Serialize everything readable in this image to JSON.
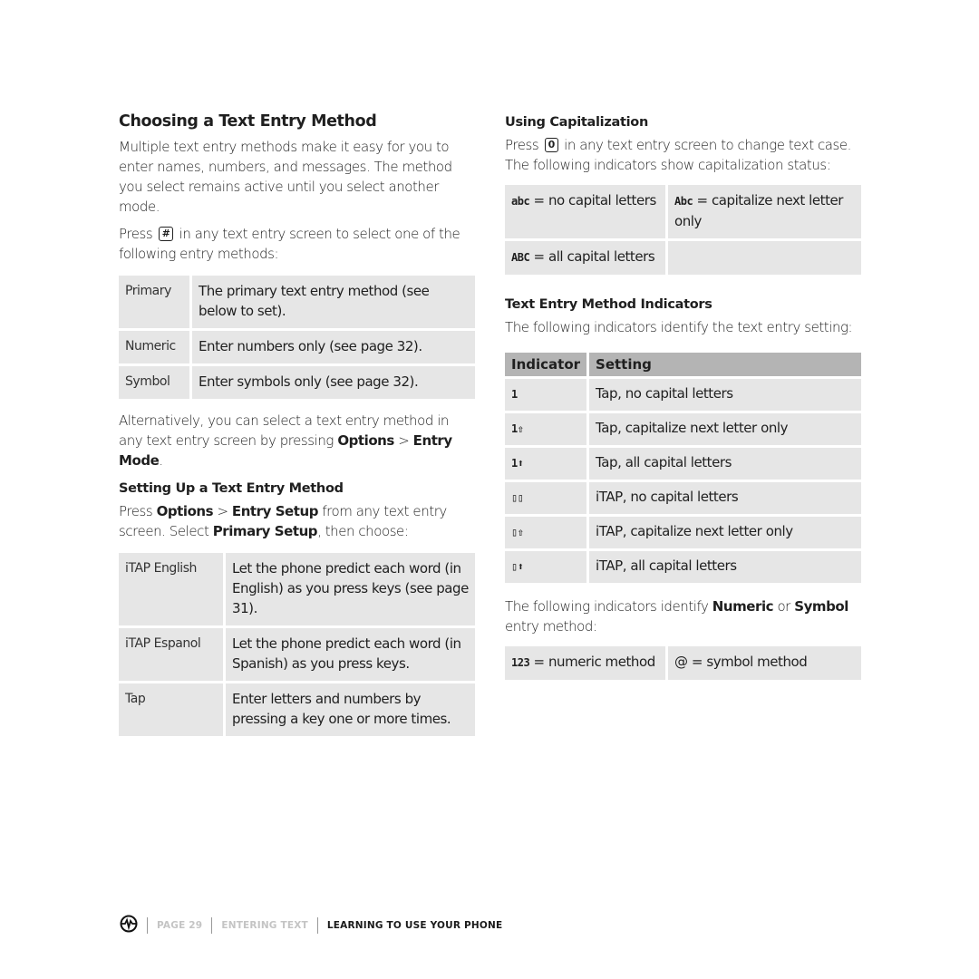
{
  "left": {
    "title": "Choosing a Text Entry Method",
    "intro": "Multiple text entry methods make it easy for you to enter names, numbers, and messages. The method you select remains active until you select another mode.",
    "press_pre": "Press",
    "press_key": "#",
    "press_post": "in any text entry screen to select one of the following entry methods:",
    "methods": [
      {
        "label": "Primary",
        "desc": "The primary text entry method (see below to set)."
      },
      {
        "label": "Numeric",
        "desc": "Enter numbers only (see page 32)."
      },
      {
        "label": "Symbol",
        "desc": "Enter symbols only (see page 32)."
      }
    ],
    "alt_pre": "Alternatively, you can select a text entry method in any text entry screen by pressing",
    "alt_b1": "Options",
    "alt_sep": " > ",
    "alt_b2": "Entry Mode",
    "alt_end": ".",
    "setup_title": "Setting Up a Text Entry Method",
    "setup_pre": "Press",
    "setup_b1": "Options",
    "setup_sep": " > ",
    "setup_b2": "Entry Setup",
    "setup_mid": " from any text entry screen. Select ",
    "setup_b3": "Primary Setup",
    "setup_end": ", then choose:",
    "setups": [
      {
        "label": "iTAP English",
        "desc": "Let the phone predict each word (in English) as you press keys (see page 31)."
      },
      {
        "label": "iTAP Espanol",
        "desc": "Let the phone predict each word (in Spanish) as you press keys."
      },
      {
        "label": "Tap",
        "desc": "Enter letters and numbers by pressing a key one or more times."
      }
    ]
  },
  "right": {
    "cap_title": "Using Capitalization",
    "cap_pre": "Press",
    "cap_key": "0",
    "cap_post": "in any text entry screen to change text case. The following indicators show capitalization status:",
    "cap": {
      "lower_ind": "abc",
      "lower_desc": "= no capital letters",
      "next_ind": "Abc",
      "next_desc": "= capitalize next letter only",
      "all_ind": "ABC",
      "all_desc": "= all capital letters"
    },
    "ind_title": "Text Entry Method Indicators",
    "ind_intro": "The following indicators identify the text entry setting:",
    "ind_headers": [
      "Indicator",
      "Setting"
    ],
    "indicators": [
      {
        "icon": "tap-lower-icon",
        "glyph": "1",
        "setting": "Tap, no capital letters"
      },
      {
        "icon": "tap-next-cap-icon",
        "glyph": "1⇧",
        "setting": "Tap, capitalize next letter only"
      },
      {
        "icon": "tap-all-caps-icon",
        "glyph": "1⬆",
        "setting": "Tap, all capital letters"
      },
      {
        "icon": "itap-lower-icon",
        "glyph": "▯▯",
        "setting": "iTAP, no capital letters"
      },
      {
        "icon": "itap-next-cap-icon",
        "glyph": "▯⇧",
        "setting": "iTAP, capitalize next letter only"
      },
      {
        "icon": "itap-all-caps-icon",
        "glyph": "▯⬆",
        "setting": "iTAP, all capital letters"
      }
    ],
    "num_pre": "The following indicators identify ",
    "num_b1": "Numeric",
    "num_mid": " or ",
    "num_b2": "Symbol",
    "num_end": " entry method:",
    "numeric_ind": "123",
    "numeric_desc": "= numeric method",
    "symbol_ind": "@",
    "symbol_desc": "= symbol method"
  },
  "footer": {
    "page": "PAGE 29",
    "section": "ENTERING TEXT",
    "chapter": "LEARNING TO USE YOUR PHONE"
  }
}
